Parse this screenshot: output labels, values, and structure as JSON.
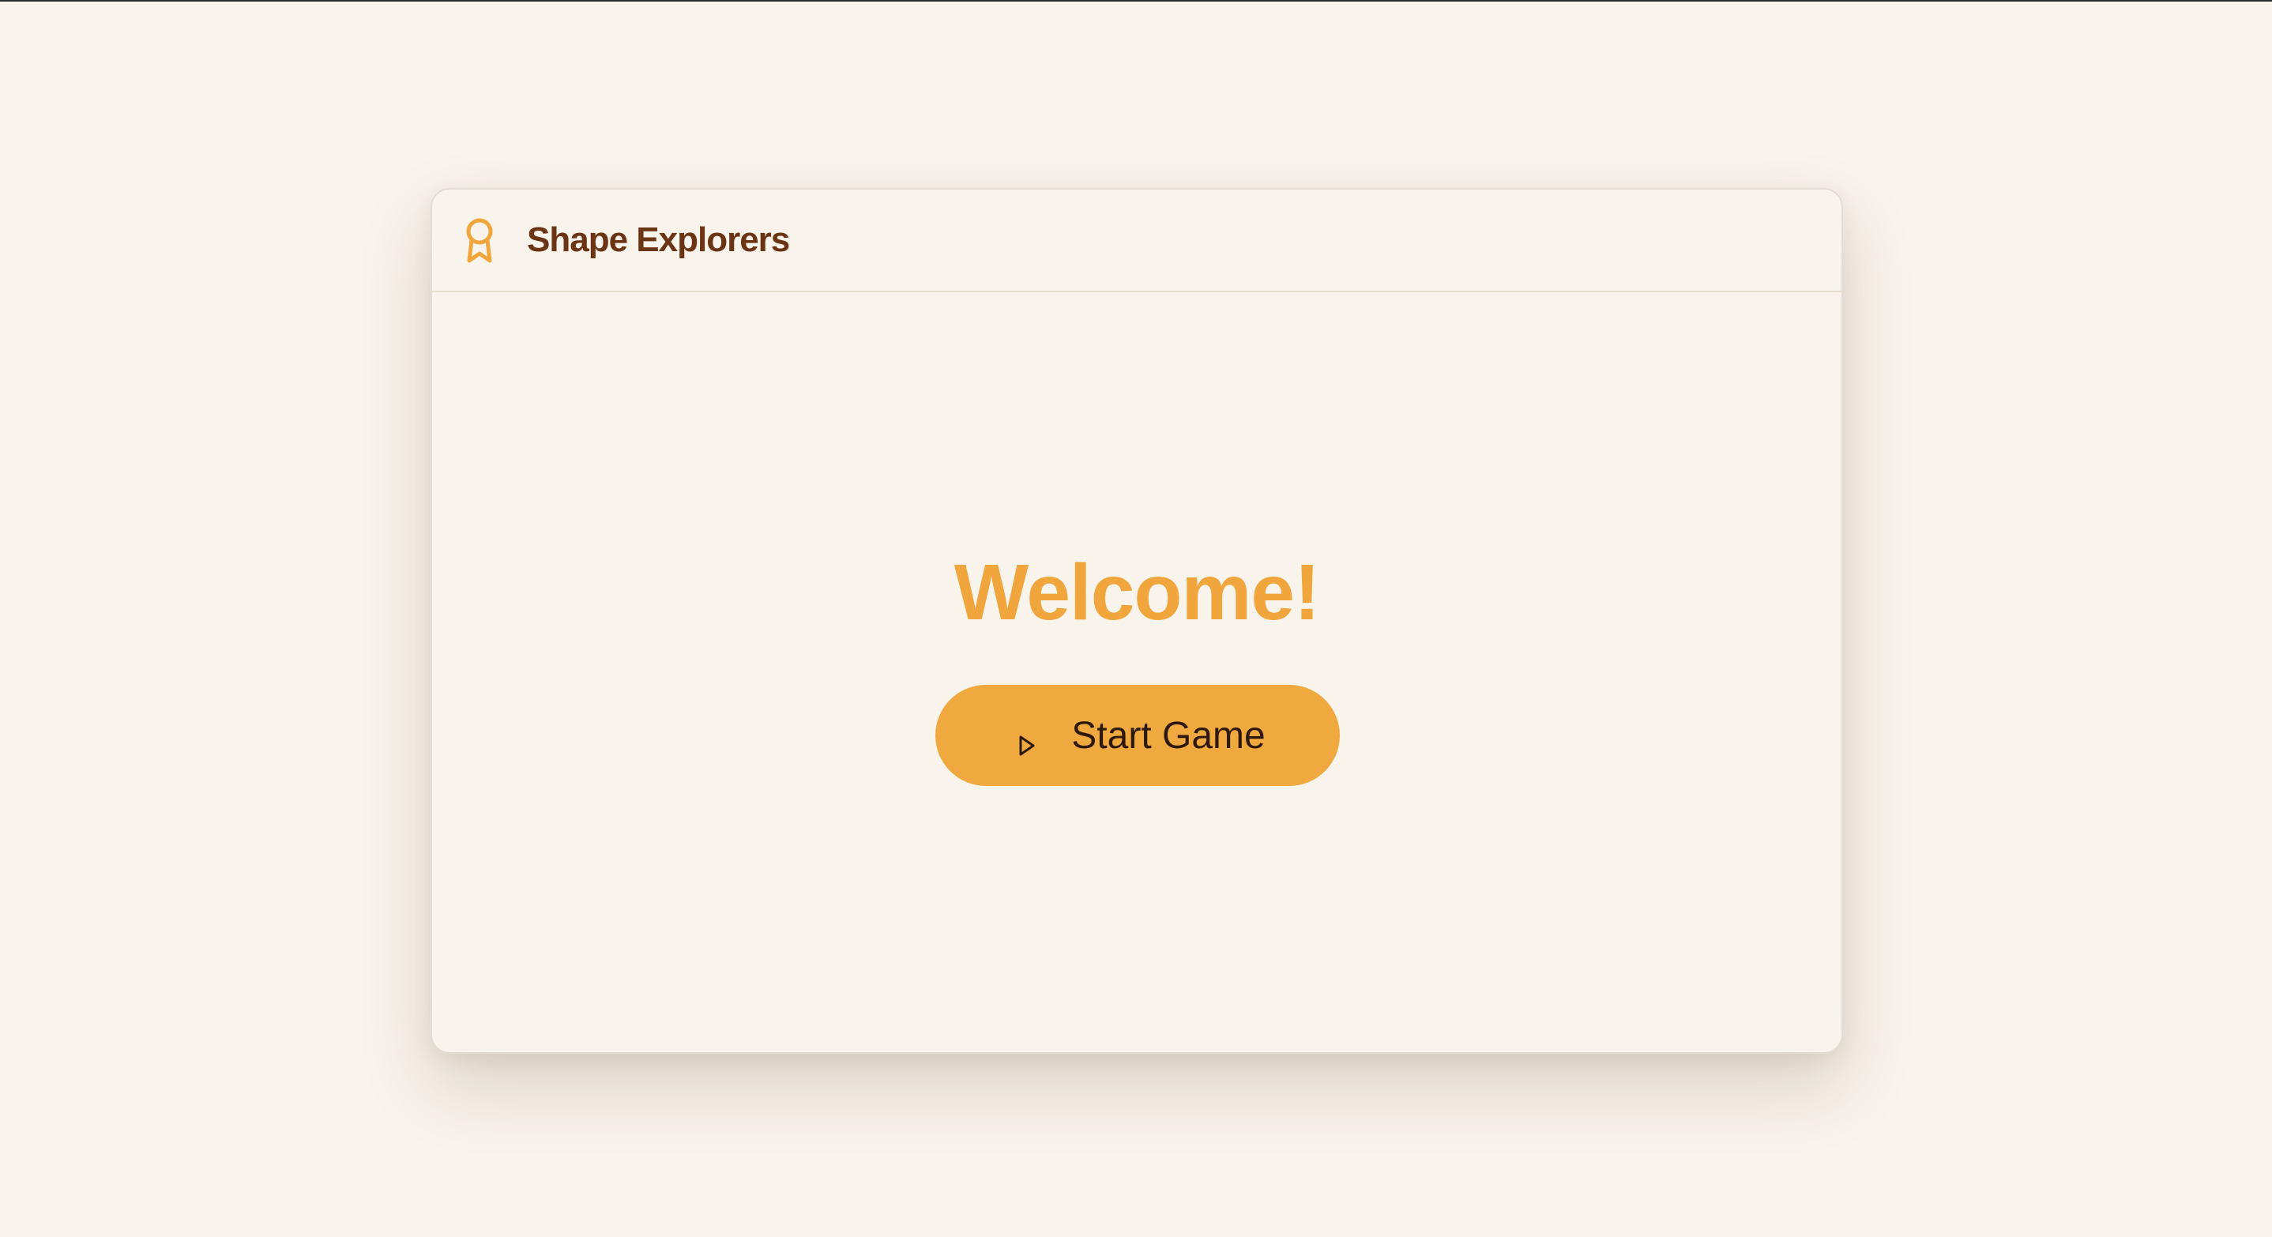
{
  "app": {
    "title": "Shape Explorers",
    "brand_icon": "award-ribbon-icon"
  },
  "main": {
    "heading": "Welcome!",
    "start_button": {
      "label": "Start Game",
      "icon": "play-icon"
    }
  },
  "colors": {
    "page_background": "#f8f3eb",
    "accent": "#f0a63c",
    "title_brown": "#6b3414",
    "button_text": "#2e1a0c"
  }
}
